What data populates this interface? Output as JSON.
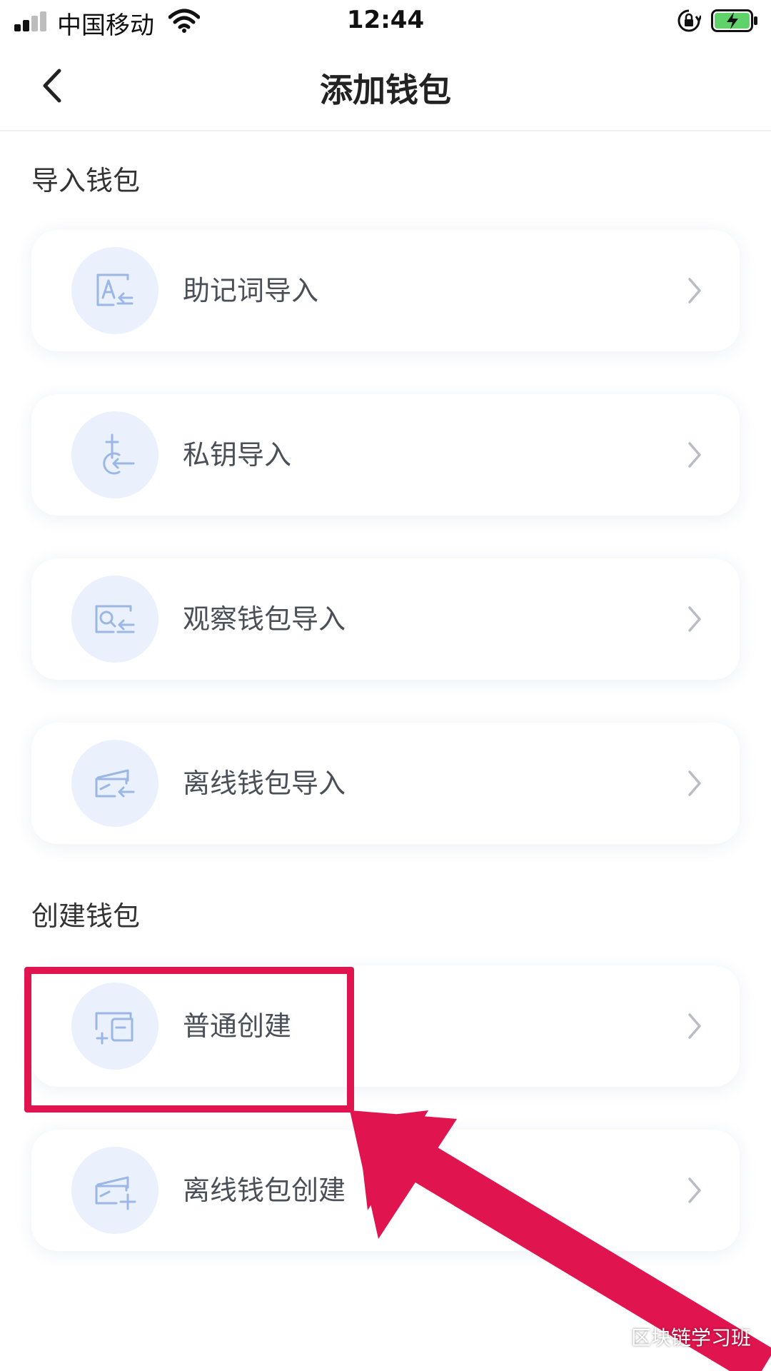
{
  "status_bar": {
    "carrier": "中国移动",
    "time": "12:44"
  },
  "nav": {
    "title": "添加钱包"
  },
  "import_section": {
    "title": "导入钱包",
    "items": [
      {
        "label": "助记词导入",
        "icon": "mnemonic-import-icon"
      },
      {
        "label": "私钥导入",
        "icon": "private-key-import-icon"
      },
      {
        "label": "观察钱包导入",
        "icon": "watch-wallet-import-icon"
      },
      {
        "label": "离线钱包导入",
        "icon": "offline-wallet-import-icon"
      }
    ]
  },
  "create_section": {
    "title": "创建钱包",
    "items": [
      {
        "label": "普通创建",
        "icon": "normal-create-icon"
      },
      {
        "label": "离线钱包创建",
        "icon": "offline-wallet-create-icon"
      }
    ]
  },
  "watermark": {
    "text": "区块链学习班"
  },
  "colors": {
    "icon_bg": "#eaf1fc",
    "icon_stroke": "#9ab7e6",
    "highlight": "#e0144e"
  }
}
